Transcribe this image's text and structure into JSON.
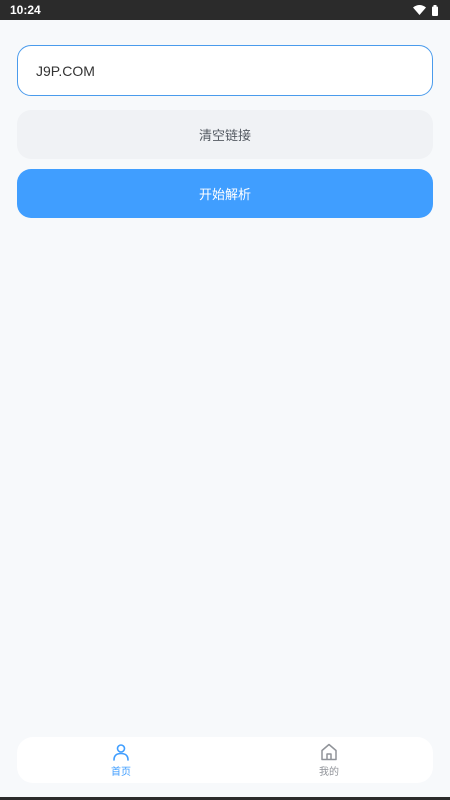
{
  "status_bar": {
    "time": "10:24",
    "icons": [
      "wifi-icon",
      "battery-icon"
    ]
  },
  "main": {
    "url_input": {
      "value": "J9P.COM",
      "placeholder": ""
    },
    "clear_button_label": "清空链接",
    "parse_button_label": "开始解析"
  },
  "tab_bar": {
    "tabs": [
      {
        "label": "首页",
        "icon": "user-icon",
        "active": true
      },
      {
        "label": "我的",
        "icon": "home-icon",
        "active": false
      }
    ]
  },
  "colors": {
    "accent": "#409eff",
    "input_border": "#4a9bec",
    "clear_button_bg": "#f0f2f5",
    "background": "#f7f9fb",
    "inactive_tab": "#909399"
  }
}
